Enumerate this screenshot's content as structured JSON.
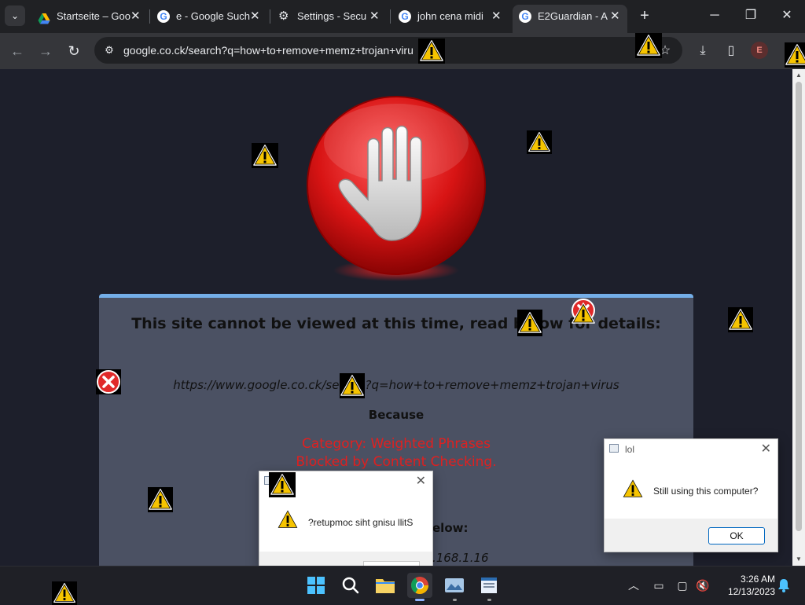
{
  "browser": {
    "tabs": [
      {
        "title": "Startseite – Goo",
        "icon": "google-drive-icon"
      },
      {
        "title": "e - Google Such",
        "icon": "google-icon"
      },
      {
        "title": "Settings - Secu",
        "icon": "gear-icon"
      },
      {
        "title": "john cena midi",
        "icon": "google-icon"
      },
      {
        "title": "E2Guardian - A",
        "icon": "google-icon",
        "active": true
      }
    ],
    "tab_menu": "⌄",
    "new_tab": "+",
    "close_glyph": "✕",
    "window_controls": {
      "minimize": "─",
      "maximize": "❐",
      "close": "✕"
    },
    "nav": {
      "back": "←",
      "forward": "→",
      "reload": "↻"
    },
    "address": "google.co.ck/search?q=how+to+remove+memz+trojan+viru",
    "site_info_icon": "⚙",
    "toolbar_icons": {
      "bookmark": "☆",
      "download": "⤓",
      "sidepanel": "▯"
    },
    "profile_initial": "E"
  },
  "page": {
    "headline": "This site cannot be viewed at this time, read below for details:",
    "blocked_url": "https://www.google.co.ck/search?q=how+to+remove+memz+trojan+virus",
    "because": "Because",
    "reason_category": "Category: Weighted Phrases",
    "reason_detail": "Blocked by Content Checking.",
    "partial_below": "elow:",
    "partial_ip": ".168.1.16",
    "colors": {
      "reason": "#e02020",
      "panel_bg": "#4b5163",
      "panel_border": "#74aee8",
      "page_bg": "#1d1f2b"
    }
  },
  "dialogs": {
    "lol": {
      "title": "lol",
      "message": "Still using this computer?",
      "ok": "OK",
      "close": "✕"
    },
    "reversed": {
      "message": "?retupmoc siht gnisu llitS",
      "close": "✕"
    }
  },
  "taskbar": {
    "apps": [
      "windows-start-icon",
      "search-icon",
      "file-explorer-icon",
      "chrome-icon",
      "photos-icon",
      "notepad-icon"
    ],
    "tray": {
      "chevron": "︿",
      "network": "▭",
      "display": "▢",
      "sound": "🔇"
    },
    "time": "3:26 AM",
    "date": "12/13/2023"
  }
}
